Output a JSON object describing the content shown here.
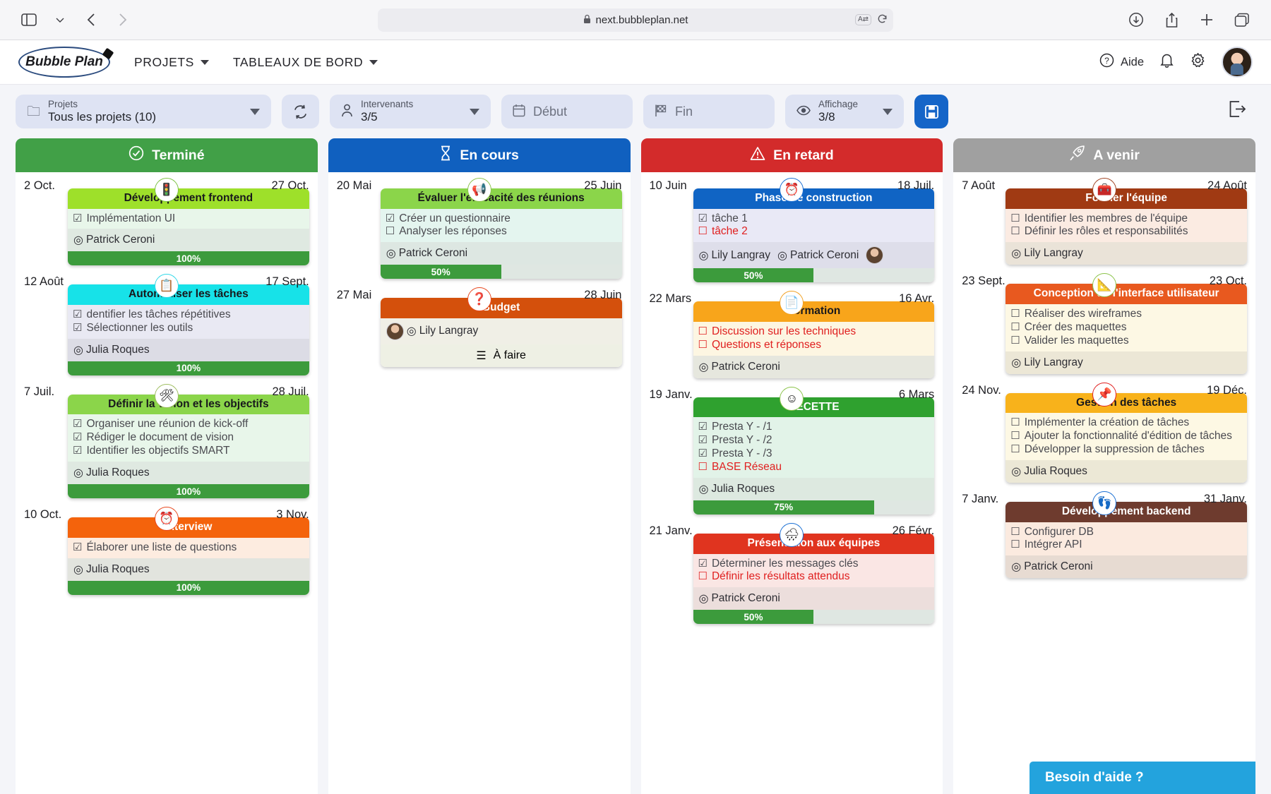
{
  "browser": {
    "url": "next.bubbleplan.net",
    "lock_icon": "lock-icon",
    "sidebar_icon": "sidebar-toggle-icon",
    "back_icon": "back-arrow-icon",
    "forward_icon": "forward-arrow-icon",
    "download_icon": "download-icon",
    "share_icon": "share-icon",
    "newtab_icon": "plus-icon",
    "tabs_icon": "tab-overview-icon",
    "translate_label": "A⇄",
    "reload_icon": "reload-icon"
  },
  "header": {
    "logo_text": "Bubble Plan",
    "nav": [
      {
        "label": "PROJETS"
      },
      {
        "label": "TABLEAUX DE BORD"
      }
    ],
    "help_label": "Aide",
    "help_icon": "question-circle-icon",
    "bell_icon": "bell-icon",
    "gear_icon": "gear-icon",
    "avatar_name": "user-avatar"
  },
  "toolbar": {
    "projets": {
      "label": "Projets",
      "value": "Tous les projets (10)",
      "icon": "folder-icon"
    },
    "refresh_icon": "refresh-icon",
    "intervenants": {
      "label": "Intervenants",
      "value": "3/5",
      "icon": "person-icon"
    },
    "debut": {
      "placeholder": "Début",
      "icon": "calendar-icon"
    },
    "fin": {
      "placeholder": "Fin",
      "icon": "checkered-flag-icon"
    },
    "affichage": {
      "label": "Affichage",
      "value": "3/8",
      "icon": "eye-icon"
    },
    "save_icon": "floppy-save-icon",
    "export_icon": "export-icon"
  },
  "help_widget": {
    "label": "Besoin d'aide ?"
  },
  "columns": [
    {
      "name": "termine",
      "title": "Terminé",
      "icon": "check-circle-icon",
      "color": "#41a047",
      "tasks": [
        {
          "start": "2 Oct.",
          "end": "27 Oct.",
          "bubble_icon": "traffic-light-icon",
          "bubble_glyph": "🚦",
          "ring": "#7cc242",
          "title": "Développement frontend",
          "title_bg": "#9ee02a",
          "title_color": "#18181c",
          "tasks_bg": "#e8f6ea",
          "items": [
            {
              "text": "Implémentation UI",
              "checked": true,
              "late": false
            }
          ],
          "people_bg": "#dfe9e1",
          "people": [
            {
              "name": "Patrick Ceroni",
              "avatar": false
            }
          ],
          "progress": 100,
          "progress_label": "100%"
        },
        {
          "start": "12 Août",
          "end": "17 Sept.",
          "bubble_icon": "checklist-icon",
          "bubble_glyph": "📋",
          "ring": "#2fd8e8",
          "title": "Automatiser les tâches",
          "title_bg": "#17e2e8",
          "title_color": "#18181c",
          "tasks_bg": "#e9e9f3",
          "items": [
            {
              "text": "dentifier les tâches répétitives",
              "checked": true,
              "late": false
            },
            {
              "text": "Sélectionner les outils",
              "checked": true,
              "late": false
            }
          ],
          "people_bg": "#dcdce5",
          "people": [
            {
              "name": "Julia Roques",
              "avatar": false
            }
          ],
          "progress": 100,
          "progress_label": "100%"
        },
        {
          "start": "7 Juil.",
          "end": "28 Juil.",
          "bubble_icon": "tools-icon",
          "bubble_glyph": "🛠",
          "ring": "#9fbe61",
          "title": "Définir la vision et les objectifs",
          "title_bg": "#8bd54a",
          "title_color": "#18181c",
          "tasks_bg": "#e8f6ea",
          "items": [
            {
              "text": "Organiser une réunion de kick-off",
              "checked": true,
              "late": false
            },
            {
              "text": "Rédiger le document de vision",
              "checked": true,
              "late": false
            },
            {
              "text": "Identifier les objectifs SMART",
              "checked": true,
              "late": false
            }
          ],
          "people_bg": "#dfe9e1",
          "people": [
            {
              "name": "Julia Roques",
              "avatar": false
            }
          ],
          "progress": 100,
          "progress_label": "100%"
        },
        {
          "start": "10 Oct.",
          "end": "3 Nov.",
          "bubble_icon": "alarm-clock-icon",
          "bubble_glyph": "⏰",
          "ring": "#e8481f",
          "title": "Interview",
          "title_bg": "#f4630c",
          "title_color": "#ffffff",
          "tasks_bg": "#fdece0",
          "items": [
            {
              "text": "Élaborer une liste de questions",
              "checked": true,
              "late": false
            }
          ],
          "people_bg": "#e2e4de",
          "people": [
            {
              "name": "Julia Roques",
              "avatar": false
            }
          ],
          "progress": 100,
          "progress_label": "100%"
        }
      ]
    },
    {
      "name": "en-cours",
      "title": "En cours",
      "icon": "hourglass-icon",
      "color": "#1060bf",
      "tasks": [
        {
          "start": "20 Mai",
          "end": "25 Juin",
          "bubble_icon": "megaphone-icon",
          "bubble_glyph": "📢",
          "ring": "#8bc34a",
          "title": "Évaluer l'efficacité des réunions",
          "title_bg": "#8bd54a",
          "title_color": "#18181c",
          "tasks_bg": "#e4f5ef",
          "items": [
            {
              "text": "Créer un questionnaire",
              "checked": true,
              "late": false
            },
            {
              "text": "Analyser les réponses",
              "checked": false,
              "late": false
            }
          ],
          "people_bg": "#dde7e2",
          "people": [
            {
              "name": "Patrick Ceroni",
              "avatar": false
            }
          ],
          "progress": 50,
          "progress_label": "50%"
        },
        {
          "start": "27 Mai",
          "end": "28 Juin",
          "bubble_icon": "question-mark-icon",
          "bubble_glyph": "❓",
          "ring": "#e8481f",
          "title": "Budget",
          "title_bg": "#d4500c",
          "title_color": "#ffffff",
          "tasks_bg": "#fdf2e6",
          "items": [],
          "people_bg": "#f0efe6",
          "people": [
            {
              "name": "Lily Langray",
              "avatar": true
            }
          ],
          "extra_row": {
            "icon": "checklist-icon",
            "glyph": "☰",
            "text": "À faire",
            "bg": "#eef0e4"
          },
          "progress": null,
          "progress_label": ""
        }
      ]
    },
    {
      "name": "en-retard",
      "title": "En retard",
      "icon": "warning-triangle-icon",
      "color": "#d32b2b",
      "tasks": [
        {
          "start": "10 Juin",
          "end": "18 Juil.",
          "bubble_icon": "alarm-clock-icon",
          "bubble_glyph": "⏰",
          "ring": "#1a6fd4",
          "title": "Phase de construction",
          "title_bg": "#1064c4",
          "title_color": "#ffffff",
          "tasks_bg": "#e9e9f6",
          "items": [
            {
              "text": "tâche 1",
              "checked": true,
              "late": false
            },
            {
              "text": "tâche 2",
              "checked": false,
              "late": true
            }
          ],
          "people_bg": "#dedeea",
          "people": [
            {
              "name": "Lily Langray",
              "avatar": false
            },
            {
              "name": "Patrick Ceroni",
              "avatar": false
            },
            {
              "name": "",
              "avatar": true
            }
          ],
          "progress": 50,
          "progress_label": "50%"
        },
        {
          "start": "22 Mars",
          "end": "16 Avr.",
          "bubble_icon": "document-icon",
          "bubble_glyph": "📄",
          "ring": "#f0a022",
          "title": "Formation",
          "title_bg": "#f8a51b",
          "title_color": "#18181c",
          "tasks_bg": "#fdf6e2",
          "items": [
            {
              "text": "Discussion sur les techniques",
              "checked": false,
              "late": true
            },
            {
              "text": "Questions et réponses",
              "checked": false,
              "late": true
            }
          ],
          "people_bg": "#e6e7de",
          "people": [
            {
              "name": "Patrick Ceroni",
              "avatar": false
            }
          ],
          "progress": null,
          "progress_label": ""
        },
        {
          "start": "19 Janv.",
          "end": "6 Mars",
          "bubble_icon": "smiley-icon",
          "bubble_glyph": "☺",
          "ring": "#8bc34a",
          "title": "RECETTE",
          "title_bg": "#2fa12f",
          "title_color": "#ffffff",
          "tasks_bg": "#e2f3e8",
          "items": [
            {
              "text": "Presta Y - /1",
              "checked": true,
              "late": false
            },
            {
              "text": "Presta Y - /2",
              "checked": true,
              "late": false
            },
            {
              "text": "Presta Y - /3",
              "checked": true,
              "late": false
            },
            {
              "text": "BASE Réseau",
              "checked": false,
              "late": true
            }
          ],
          "people_bg": "#dde9e0",
          "people": [
            {
              "name": "Julia Roques",
              "avatar": false
            }
          ],
          "progress": 75,
          "progress_label": "75%"
        },
        {
          "start": "21 Janv.",
          "end": "26 Févr.",
          "bubble_icon": "cloud-rain-icon",
          "bubble_glyph": "🌧",
          "ring": "#1a6fd4",
          "title": "Présentation aux équipes",
          "title_bg": "#e0341f",
          "title_color": "#ffffff",
          "tasks_bg": "#fae6e4",
          "items": [
            {
              "text": "Déterminer les messages clés",
              "checked": true,
              "late": false
            },
            {
              "text": "Définir les résultats attendus",
              "checked": false,
              "late": true
            }
          ],
          "people_bg": "#ecdedc",
          "people": [
            {
              "name": "Patrick Ceroni",
              "avatar": false
            }
          ],
          "progress": 50,
          "progress_label": "50%"
        }
      ]
    },
    {
      "name": "a-venir",
      "title": "A venir",
      "icon": "rocket-icon",
      "color": "#a0a0a0",
      "tasks": [
        {
          "start": "7 Août",
          "end": "24 Août",
          "bubble_icon": "toolbox-icon",
          "bubble_glyph": "🧰",
          "ring": "#a04322",
          "title": "Former l'équipe",
          "title_bg": "#a03a13",
          "title_color": "#ffffff",
          "tasks_bg": "#fbebe2",
          "items": [
            {
              "text": "Identifier les membres de l'équipe",
              "checked": false,
              "late": false
            },
            {
              "text": "Définir les rôles et responsabilités",
              "checked": false,
              "late": false
            }
          ],
          "people_bg": "#eae3d8",
          "people": [
            {
              "name": "Lily Langray",
              "avatar": false
            }
          ],
          "progress": null,
          "progress_label": ""
        },
        {
          "start": "23 Sept.",
          "end": "23 Oct.",
          "bubble_icon": "ruler-pencil-icon",
          "bubble_glyph": "📐",
          "ring": "#8bc34a",
          "title": "Conception de l'interface utilisateur",
          "title_bg": "#e8591f",
          "title_color": "#ffffff",
          "tasks_bg": "#fdf8e4",
          "items": [
            {
              "text": "Réaliser des wireframes",
              "checked": false,
              "late": false
            },
            {
              "text": "Créer des maquettes",
              "checked": false,
              "late": false
            },
            {
              "text": "Valider les maquettes",
              "checked": false,
              "late": false
            }
          ],
          "people_bg": "#ece7d6",
          "people": [
            {
              "name": "Lily Langray",
              "avatar": false
            }
          ],
          "progress": null,
          "progress_label": ""
        },
        {
          "start": "24 Nov.",
          "end": "19 Déc.",
          "bubble_icon": "pushpin-icon",
          "bubble_glyph": "📌",
          "ring": "#e02020",
          "title": "Gestion des tâches",
          "title_bg": "#f8b21b",
          "title_color": "#18181c",
          "tasks_bg": "#fdf8e4",
          "items": [
            {
              "text": "Implémenter la création de tâches",
              "checked": false,
              "late": false
            },
            {
              "text": "Ajouter la fonctionnalité d'édition de tâches",
              "checked": false,
              "late": false
            },
            {
              "text": "Développer la suppression de tâches",
              "checked": false,
              "late": false
            }
          ],
          "people_bg": "#ece8d6",
          "people": [
            {
              "name": "Julia Roques",
              "avatar": false
            }
          ],
          "progress": null,
          "progress_label": ""
        },
        {
          "start": "7 Janv.",
          "end": "31 Janv.",
          "bubble_icon": "footprints-icon",
          "bubble_glyph": "👣",
          "ring": "#1a6fd4",
          "title": "Développement backend",
          "title_bg": "#6e3b2e",
          "title_color": "#ffffff",
          "tasks_bg": "#fbeadf",
          "items": [
            {
              "text": "Configurer DB",
              "checked": false,
              "late": false
            },
            {
              "text": "Intégrer API",
              "checked": false,
              "late": false
            }
          ],
          "people_bg": "#e7dbd2",
          "people": [
            {
              "name": "Patrick Ceroni",
              "avatar": false
            }
          ],
          "progress": null,
          "progress_label": ""
        }
      ]
    }
  ]
}
